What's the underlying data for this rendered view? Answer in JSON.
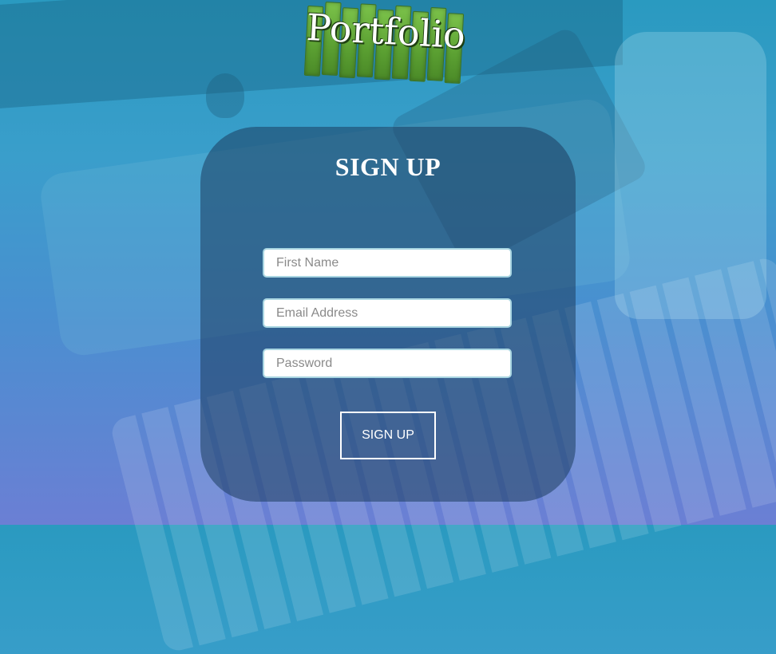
{
  "logo": {
    "text": "Portfolio"
  },
  "form": {
    "title": "SIGN UP",
    "first_name": {
      "value": "",
      "placeholder": "First Name"
    },
    "email": {
      "value": "",
      "placeholder": "Email Address"
    },
    "password": {
      "value": "",
      "placeholder": "Password"
    },
    "submit_label": "SIGN UP"
  },
  "colors": {
    "card_background": "#1c3c5f",
    "field_border": "#a9d6e2",
    "logo_green": "#5ba032"
  }
}
